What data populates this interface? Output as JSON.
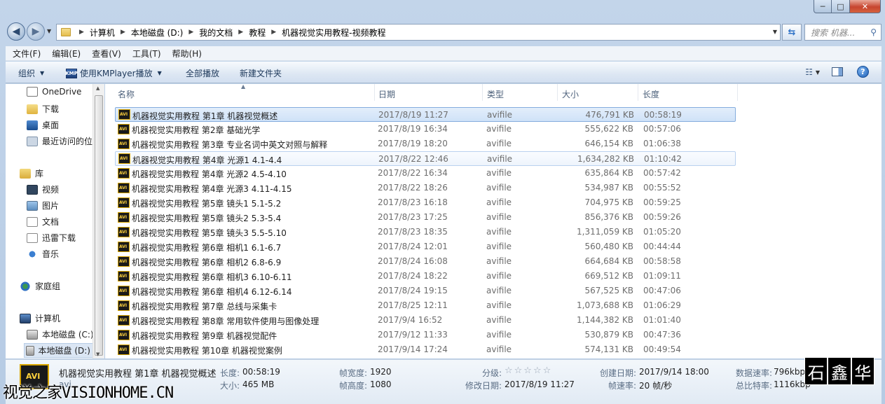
{
  "window": {
    "min_label": "─",
    "max_label": "□",
    "close_label": "✕"
  },
  "address": {
    "crumbs": [
      "计算机",
      "本地磁盘 (D:)",
      "我的文档",
      "教程",
      "机器视觉实用教程-视频教程"
    ],
    "search_placeholder": "搜索 机器..."
  },
  "menu": [
    "文件(F)",
    "编辑(E)",
    "查看(V)",
    "工具(T)",
    "帮助(H)"
  ],
  "toolbar": {
    "organize": "组织",
    "play_with": "使用KMPlayer播放",
    "play_all": "全部播放",
    "new_folder": "新建文件夹"
  },
  "nav": {
    "onedrive": "OneDrive",
    "downloads": "下载",
    "desktop": "桌面",
    "recent": "最近访问的位",
    "libraries": "库",
    "videos": "视频",
    "pictures": "图片",
    "documents": "文档",
    "xunlei": "迅雷下载",
    "music": "音乐",
    "homegroup": "家庭组",
    "computer": "计算机",
    "drive_c": "本地磁盘 (C:)",
    "drive_d": "本地磁盘 (D:)"
  },
  "columns": {
    "name": "名称",
    "date": "日期",
    "type": "类型",
    "size": "大小",
    "length": "长度"
  },
  "files": [
    {
      "name": "机器视觉实用教程 第1章 机器视觉概述",
      "date": "2017/8/19 11:27",
      "type": "avifile",
      "size": "476,791 KB",
      "length": "00:58:19"
    },
    {
      "name": "机器视觉实用教程 第2章 基础光学",
      "date": "2017/8/19 16:34",
      "type": "avifile",
      "size": "555,622 KB",
      "length": "00:57:06"
    },
    {
      "name": "机器视觉实用教程 第3章 专业名词中英文对照与解释",
      "date": "2017/8/19 18:20",
      "type": "avifile",
      "size": "646,154 KB",
      "length": "01:06:38"
    },
    {
      "name": "机器视觉实用教程 第4章 光源1 4.1-4.4",
      "date": "2017/8/22 12:46",
      "type": "avifile",
      "size": "1,634,282 KB",
      "length": "01:10:42"
    },
    {
      "name": "机器视觉实用教程 第4章 光源2 4.5-4.10",
      "date": "2017/8/22 16:34",
      "type": "avifile",
      "size": "635,864 KB",
      "length": "00:57:42"
    },
    {
      "name": "机器视觉实用教程 第4章 光源3 4.11-4.15",
      "date": "2017/8/22 18:26",
      "type": "avifile",
      "size": "534,987 KB",
      "length": "00:55:52"
    },
    {
      "name": "机器视觉实用教程 第5章 镜头1 5.1-5.2",
      "date": "2017/8/23 16:18",
      "type": "avifile",
      "size": "704,975 KB",
      "length": "00:59:25"
    },
    {
      "name": "机器视觉实用教程 第5章 镜头2 5.3-5.4",
      "date": "2017/8/23 17:25",
      "type": "avifile",
      "size": "856,376 KB",
      "length": "00:59:26"
    },
    {
      "name": "机器视觉实用教程 第5章 镜头3 5.5-5.10",
      "date": "2017/8/23 18:35",
      "type": "avifile",
      "size": "1,311,059 KB",
      "length": "01:05:20"
    },
    {
      "name": "机器视觉实用教程 第6章 相机1 6.1-6.7",
      "date": "2017/8/24 12:01",
      "type": "avifile",
      "size": "560,480 KB",
      "length": "00:44:44"
    },
    {
      "name": "机器视觉实用教程 第6章 相机2 6.8-6.9",
      "date": "2017/8/24 16:08",
      "type": "avifile",
      "size": "664,684 KB",
      "length": "00:58:58"
    },
    {
      "name": "机器视觉实用教程 第6章 相机3 6.10-6.11",
      "date": "2017/8/24 18:22",
      "type": "avifile",
      "size": "669,512 KB",
      "length": "01:09:11"
    },
    {
      "name": "机器视觉实用教程 第6章 相机4 6.12-6.14",
      "date": "2017/8/24 19:15",
      "type": "avifile",
      "size": "567,525 KB",
      "length": "00:47:06"
    },
    {
      "name": "机器视觉实用教程 第7章 总线与采集卡",
      "date": "2017/8/25 12:11",
      "type": "avifile",
      "size": "1,073,688 KB",
      "length": "01:06:29"
    },
    {
      "name": "机器视觉实用教程 第8章 常用软件使用与图像处理",
      "date": "2017/9/4 16:52",
      "type": "avifile",
      "size": "1,144,382 KB",
      "length": "01:01:40"
    },
    {
      "name": "机器视觉实用教程 第9章 机器视觉配件",
      "date": "2017/9/12 11:33",
      "type": "avifile",
      "size": "530,879 KB",
      "length": "00:47:36"
    },
    {
      "name": "机器视觉实用教程 第10章 机器视觉案例",
      "date": "2017/9/14 17:24",
      "type": "avifile",
      "size": "574,131 KB",
      "length": "00:49:54"
    }
  ],
  "details": {
    "file_name": "机器视觉实用教程 第1章 机器视觉概述",
    "file_type": "avi",
    "length_label": "长度:",
    "length_value": "00:58:19",
    "size_label": "大小:",
    "size_value": "465 MB",
    "frame_width_label": "帧宽度:",
    "frame_width_value": "1920",
    "frame_height_label": "帧高度:",
    "frame_height_value": "1080",
    "rating_label": "分级:",
    "rating_stars": "☆☆☆☆☆",
    "modified_label": "修改日期:",
    "modified_value": "2017/8/19 11:27",
    "created_label": "创建日期:",
    "created_value": "2017/9/14 18:00",
    "framerate_label": "帧速率:",
    "framerate_value": "20 帧/秒",
    "datarate_label": "数据速率:",
    "datarate_value": "796kbp",
    "bitrate_label": "总比特率:",
    "bitrate_value": "1116kbp"
  },
  "watermark": {
    "left_text": "视觉之家VISIONHOME.CN",
    "seal": [
      "石",
      "鑫",
      "华"
    ]
  }
}
